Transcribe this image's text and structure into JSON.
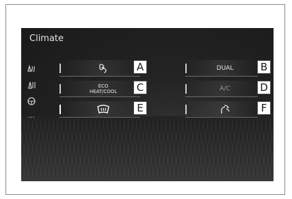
{
  "screen": {
    "title": "Climate",
    "side_icons": [
      "seat-heat-icon",
      "seat-vent-icon",
      "steering-heat-icon",
      "more-dots-icon"
    ],
    "more_label": "..."
  },
  "buttons": [
    {
      "id": "A",
      "name": "fan-defog-button",
      "label": "",
      "icon": "fan-icon"
    },
    {
      "id": "B",
      "name": "dual-button",
      "label": "DUAL"
    },
    {
      "id": "C",
      "name": "eco-heat-cool-button",
      "label_line1": "ECO",
      "label_line2": "HEAT/COOL"
    },
    {
      "id": "D",
      "name": "ac-button",
      "label": "A/C"
    },
    {
      "id": "E",
      "name": "windshield-defroster-button",
      "label": "",
      "icon": "defroster-icon"
    },
    {
      "id": "F",
      "name": "air-intake-button",
      "label": "",
      "icon": "air-intake-icon"
    }
  ],
  "callouts": {
    "A": "A",
    "B": "B",
    "C": "C",
    "D": "D",
    "E": "E",
    "F": "F"
  }
}
